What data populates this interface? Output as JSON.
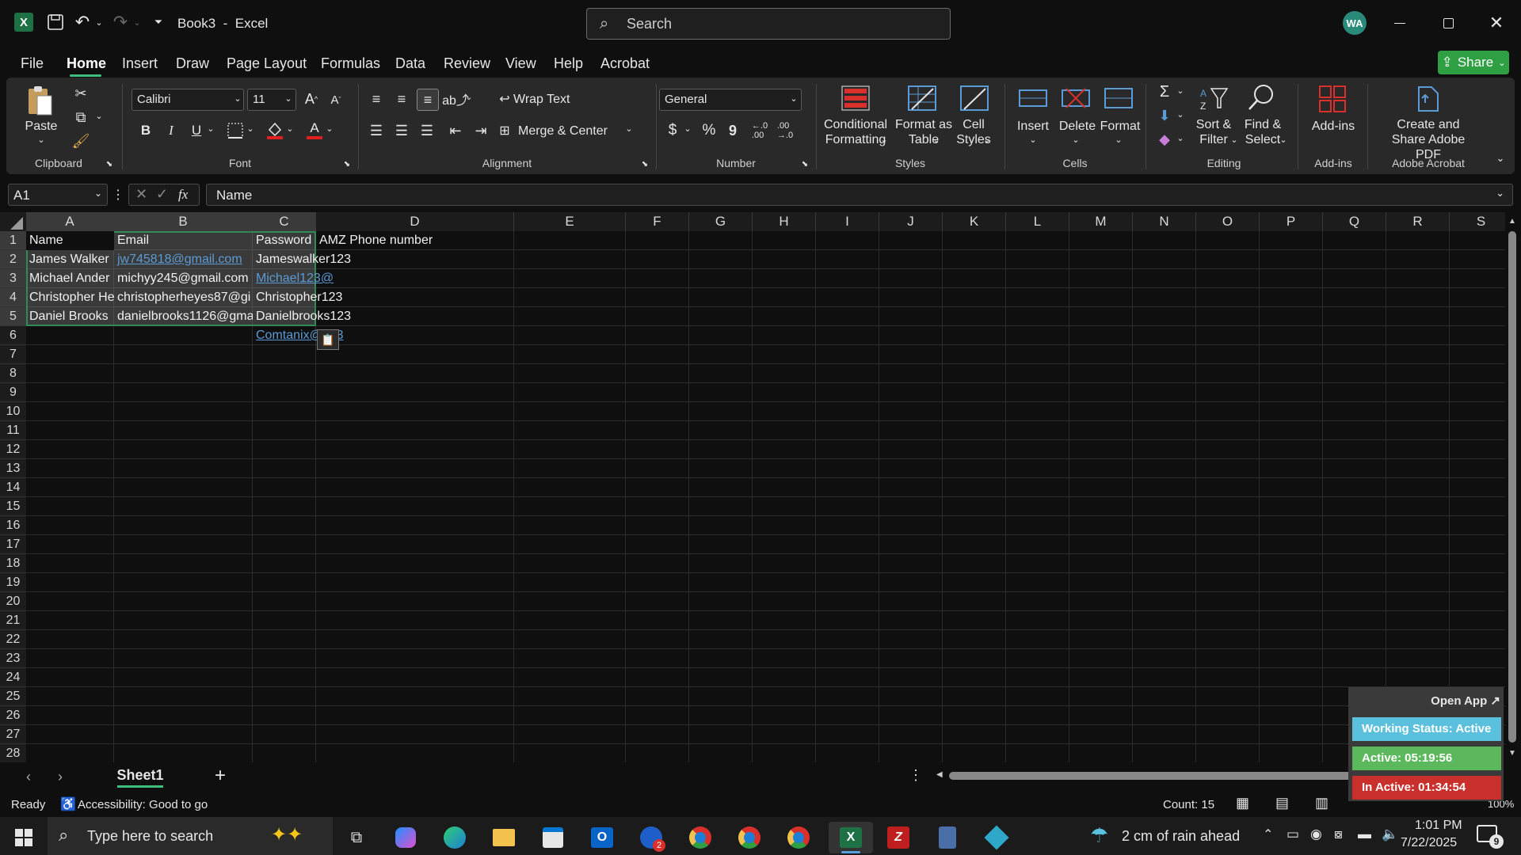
{
  "window": {
    "title": "Book3  -  Excel",
    "search_placeholder": "Search",
    "user_initials": "WA"
  },
  "menu": {
    "tabs": [
      "File",
      "Home",
      "Insert",
      "Draw",
      "Page Layout",
      "Formulas",
      "Data",
      "Review",
      "View",
      "Help",
      "Acrobat"
    ],
    "active_tab": "Home",
    "share_label": "Share"
  },
  "ribbon": {
    "clipboard": {
      "label": "Clipboard",
      "paste": "Paste"
    },
    "font": {
      "label": "Font",
      "name": "Calibri",
      "size": "11",
      "bold": "B",
      "italic": "I",
      "underline": "U"
    },
    "alignment": {
      "label": "Alignment",
      "wrap_text": "Wrap Text",
      "merge_center": "Merge & Center"
    },
    "number": {
      "label": "Number",
      "format": "General",
      "currency": "$",
      "percent": "%",
      "comma": "9"
    },
    "styles": {
      "label": "Styles",
      "conditional": "Conditional Formatting",
      "format_table": "Format as Table",
      "cell_styles": "Cell Styles"
    },
    "cells": {
      "label": "Cells",
      "insert": "Insert",
      "delete": "Delete",
      "format": "Format"
    },
    "editing": {
      "label": "Editing",
      "sort_filter": "Sort & Filter",
      "find_select": "Find & Select"
    },
    "addins": {
      "label": "Add-ins",
      "addins_btn": "Add-ins"
    },
    "acrobat": {
      "label": "Adobe Acrobat",
      "create_share": "Create and Share Adobe PDF"
    }
  },
  "formula_bar": {
    "name_box": "A1",
    "fx": "fx",
    "content": "Name"
  },
  "columns": [
    "A",
    "B",
    "C",
    "D",
    "E",
    "F",
    "G",
    "H",
    "I",
    "J",
    "K",
    "L",
    "M",
    "N",
    "O",
    "P",
    "Q",
    "R",
    "S"
  ],
  "rows": [
    "1",
    "2",
    "3",
    "4",
    "5",
    "6",
    "7",
    "8",
    "9",
    "10",
    "11",
    "12",
    "13",
    "14",
    "15",
    "16",
    "17",
    "18",
    "19",
    "20",
    "21",
    "22",
    "23",
    "24",
    "25",
    "26",
    "27",
    "28"
  ],
  "cells": {
    "A1": "Name",
    "B1": "Email",
    "C1": "Password",
    "D1": "AMZ Phone number",
    "A2": "James Walker",
    "B2": "jw745818@gmail.com",
    "C2": "Jameswalker123",
    "A3": "Michael Ander",
    "B3": "michyy245@gmail.com",
    "C3": "Michael123@",
    "A4": "Christopher He",
    "B4": "christopherheyes87@gi",
    "C4": "Christopher123",
    "A5": "Daniel Brooks",
    "B5": "danielbrooks1126@gma",
    "C5": "Danielbrooks123",
    "C6": "Comtanix@123"
  },
  "sheets": {
    "active": "Sheet1",
    "add_label": "+"
  },
  "status": {
    "ready": "Ready",
    "accessibility": "Accessibility: Good to go",
    "count": "Count: 15",
    "zoom": "100%"
  },
  "widget": {
    "open_app": "Open App ↗",
    "working": "Working Status: Active",
    "active": "Active: 05:19:56",
    "inactive": "In Active: 01:34:54"
  },
  "taskbar": {
    "search_placeholder": "Type here to search",
    "weather": "2 cm of rain ahead",
    "time": "1:01 PM",
    "date": "7/22/2025",
    "notif_count": "9",
    "badge": "2"
  },
  "colors": {
    "excel_green": "#1e7145",
    "share_green": "#2ea043",
    "link_blue": "#5b9bd5",
    "widget_blue": "#5bc0de",
    "widget_green": "#5cb85c",
    "widget_red": "#c9302c"
  }
}
